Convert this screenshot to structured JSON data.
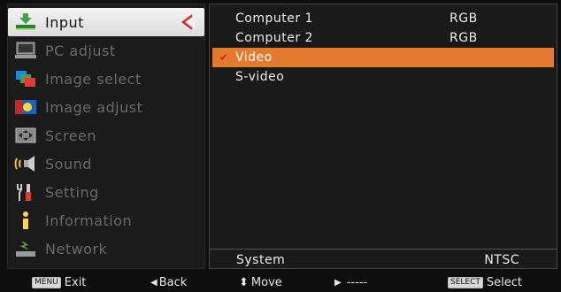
{
  "menu": {
    "items": [
      {
        "label": "Input",
        "icon": "input-icon",
        "active": true
      },
      {
        "label": "PC adjust",
        "icon": "pc-adjust-icon",
        "active": false
      },
      {
        "label": "Image select",
        "icon": "image-select-icon",
        "active": false
      },
      {
        "label": "Image adjust",
        "icon": "image-adjust-icon",
        "active": false
      },
      {
        "label": "Screen",
        "icon": "screen-icon",
        "active": false
      },
      {
        "label": "Sound",
        "icon": "sound-icon",
        "active": false
      },
      {
        "label": "Setting",
        "icon": "setting-icon",
        "active": false
      },
      {
        "label": "Information",
        "icon": "information-icon",
        "active": false
      },
      {
        "label": "Network",
        "icon": "network-icon",
        "active": false
      }
    ]
  },
  "panel": {
    "rows": [
      {
        "name": "Computer 1",
        "value": "RGB",
        "selected": false,
        "checked": false
      },
      {
        "name": "Computer 2",
        "value": "RGB",
        "selected": false,
        "checked": false
      },
      {
        "name": "Video",
        "value": "",
        "selected": true,
        "checked": true
      },
      {
        "name": "S-video",
        "value": "",
        "selected": false,
        "checked": false
      }
    ],
    "system_label": "System",
    "system_value": "NTSC",
    "check_glyph": "✔"
  },
  "footer": {
    "exit_key": "MENU",
    "exit_label": "Exit",
    "back_glyph": "◀",
    "back_label": "Back",
    "move_glyph": "⬍",
    "move_label": "Move",
    "next_glyph": "▶",
    "next_label": "-----",
    "select_key": "SELECT",
    "select_label": "Select"
  },
  "colors": {
    "highlight": "#e27a2f",
    "accent_red": "#e0201a",
    "active_bg": "#ececec"
  }
}
